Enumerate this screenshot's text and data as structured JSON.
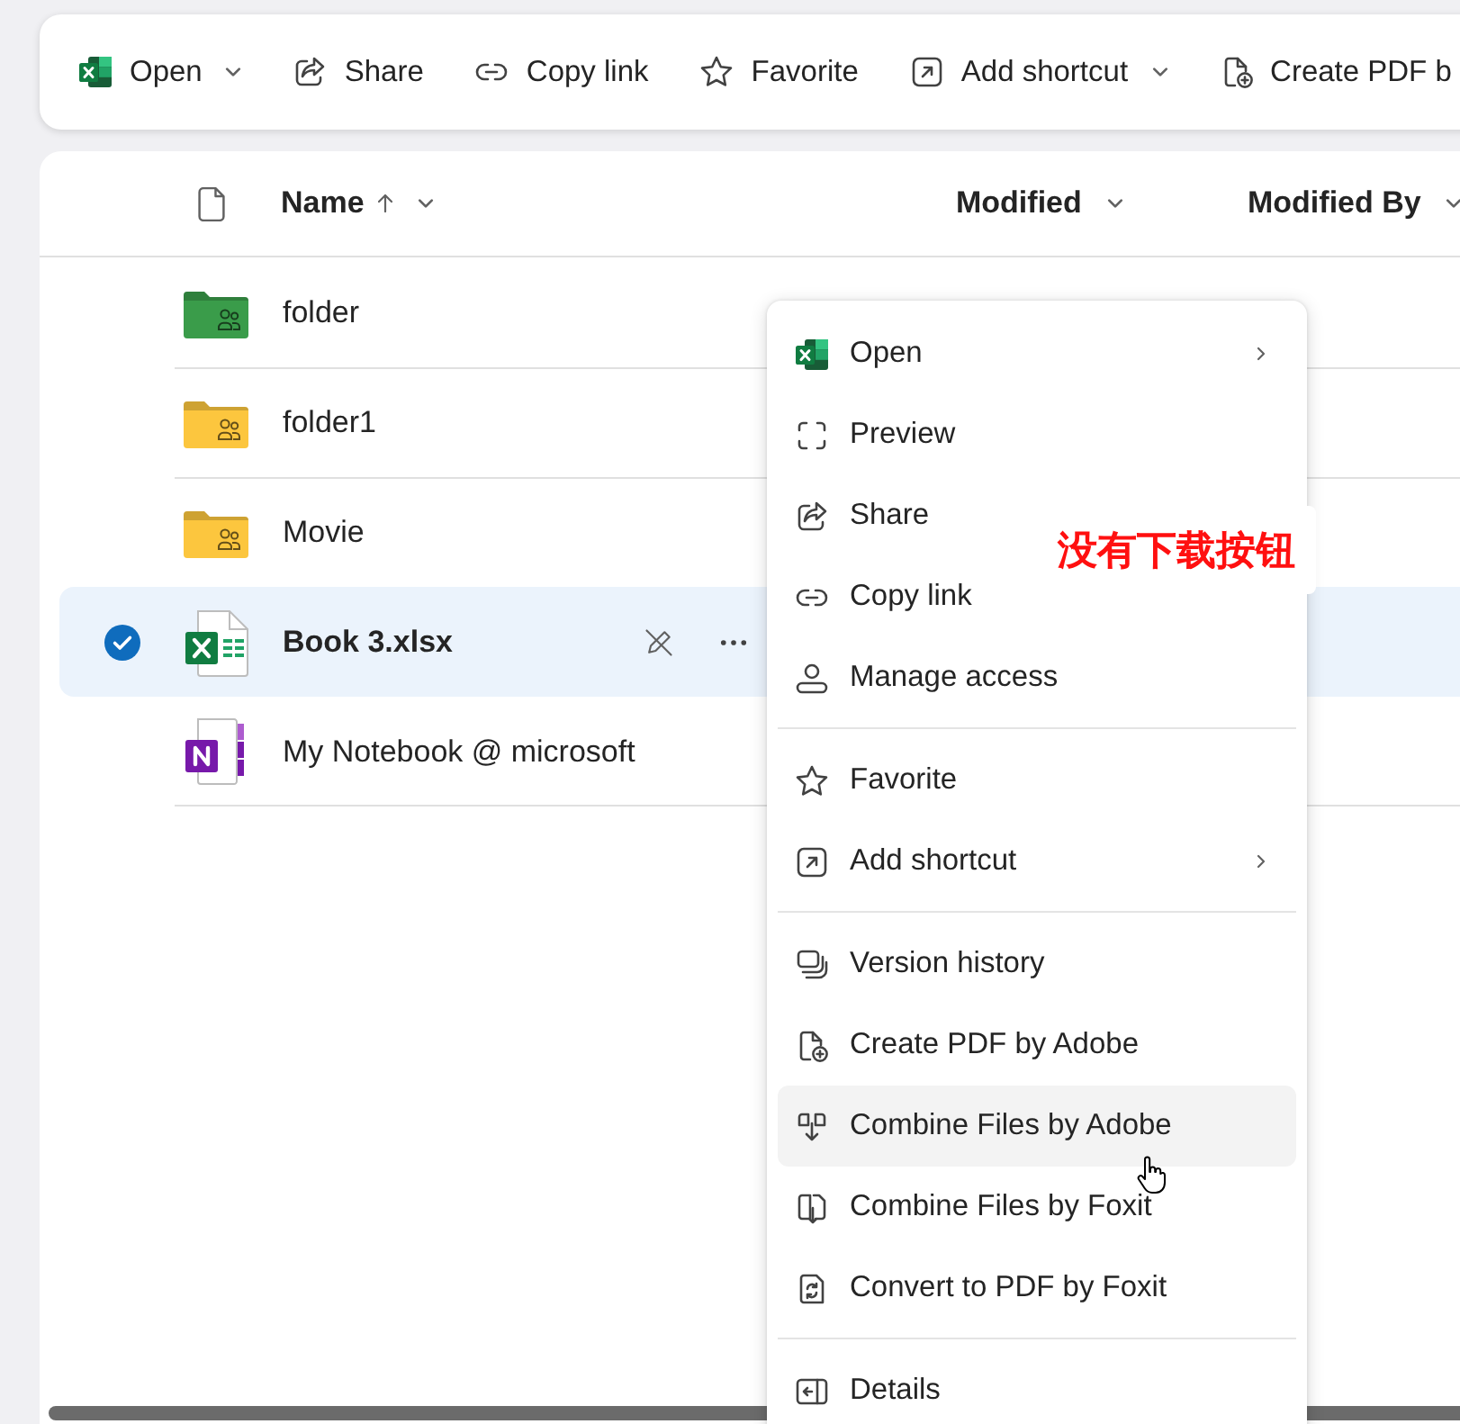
{
  "toolbar": {
    "items": [
      {
        "kind": "open",
        "label": "Open",
        "dropdown": true
      },
      {
        "kind": "share",
        "label": "Share",
        "dropdown": false
      },
      {
        "kind": "copy-link",
        "label": "Copy link",
        "dropdown": false
      },
      {
        "kind": "favorite",
        "label": "Favorite",
        "dropdown": false
      },
      {
        "kind": "add-shortcut",
        "label": "Add shortcut",
        "dropdown": true
      },
      {
        "kind": "create-pdf",
        "label": "Create PDF b",
        "dropdown": false
      }
    ]
  },
  "file_list": {
    "columns": [
      {
        "label": "Name",
        "sorted": true
      },
      {
        "label": "Modified",
        "sorted": false
      },
      {
        "label": "Modified By",
        "sorted": false
      }
    ],
    "rows": [
      {
        "kind": "folder",
        "color": "#3a9c4a",
        "name": "folder",
        "selected": false
      },
      {
        "kind": "folder",
        "color": "#fcc63e",
        "name": "folder1",
        "selected": false
      },
      {
        "kind": "folder",
        "color": "#fcc63e",
        "name": "Movie",
        "selected": false
      },
      {
        "kind": "spreadsheet",
        "name": "Book 3.xlsx",
        "selected": true
      },
      {
        "kind": "notebook",
        "name": "My Notebook @ microsoft",
        "selected": false
      }
    ]
  },
  "context_menu": {
    "groups": [
      {
        "items": [
          {
            "kind": "open",
            "label": "Open",
            "submenu": true,
            "highlighted": false
          },
          {
            "kind": "preview",
            "label": "Preview",
            "submenu": false,
            "highlighted": false
          },
          {
            "kind": "share",
            "label": "Share",
            "submenu": false,
            "highlighted": false
          },
          {
            "kind": "copy-link",
            "label": "Copy link",
            "submenu": false,
            "highlighted": false
          },
          {
            "kind": "manage-access",
            "label": "Manage access",
            "submenu": false,
            "highlighted": false
          }
        ]
      },
      {
        "items": [
          {
            "kind": "favorite",
            "label": "Favorite",
            "submenu": false,
            "highlighted": false
          },
          {
            "kind": "add-shortcut",
            "label": "Add shortcut",
            "submenu": true,
            "highlighted": false
          }
        ]
      },
      {
        "items": [
          {
            "kind": "version-history",
            "label": "Version history",
            "submenu": false,
            "highlighted": false
          },
          {
            "kind": "create-pdf",
            "label": "Create PDF by Adobe",
            "submenu": false,
            "highlighted": false
          },
          {
            "kind": "combine-adobe",
            "label": "Combine Files by Adobe",
            "submenu": false,
            "highlighted": true
          },
          {
            "kind": "combine-foxit",
            "label": "Combine Files by Foxit",
            "submenu": false,
            "highlighted": false
          },
          {
            "kind": "convert-foxit",
            "label": "Convert to PDF by Foxit",
            "submenu": false,
            "highlighted": false
          }
        ]
      },
      {
        "items": [
          {
            "kind": "details",
            "label": "Details",
            "submenu": false,
            "highlighted": false
          }
        ]
      }
    ]
  },
  "annotation": {
    "text": "没有下载按钮"
  }
}
